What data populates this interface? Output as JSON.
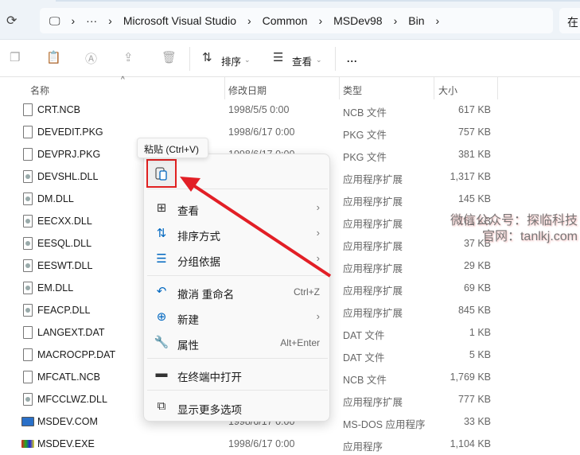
{
  "address": {
    "crumbs": [
      "Microsoft Visual Studio",
      "Common",
      "MSDev98",
      "Bin"
    ],
    "search_prefix": "在"
  },
  "toolbar": {
    "sort": "排序",
    "view": "查看",
    "more": "..."
  },
  "columns": {
    "name": "名称",
    "date": "修改日期",
    "type": "类型",
    "size": "大小"
  },
  "files": [
    {
      "name": "CRT.NCB",
      "date": "1998/5/5 0:00",
      "type": "NCB 文件",
      "size": "617 KB",
      "icon": "file"
    },
    {
      "name": "DEVEDIT.PKG",
      "date": "1998/6/17 0:00",
      "type": "PKG 文件",
      "size": "757 KB",
      "icon": "file"
    },
    {
      "name": "DEVPRJ.PKG",
      "date": "1998/6/17 0:00",
      "type": "PKG 文件",
      "size": "381 KB",
      "icon": "file"
    },
    {
      "name": "DEVSHL.DLL",
      "date": "",
      "type": "应用程序扩展",
      "size": "1,317 KB",
      "icon": "dll"
    },
    {
      "name": "DM.DLL",
      "date": "",
      "type": "应用程序扩展",
      "size": "145 KB",
      "icon": "dll"
    },
    {
      "name": "EECXX.DLL",
      "date": "",
      "type": "应用程序扩展",
      "size": "161 KB",
      "icon": "dll"
    },
    {
      "name": "EESQL.DLL",
      "date": "",
      "type": "应用程序扩展",
      "size": "37 KB",
      "icon": "dll"
    },
    {
      "name": "EESWT.DLL",
      "date": "",
      "type": "应用程序扩展",
      "size": "29 KB",
      "icon": "dll"
    },
    {
      "name": "EM.DLL",
      "date": "",
      "type": "应用程序扩展",
      "size": "69 KB",
      "icon": "dll"
    },
    {
      "name": "FEACP.DLL",
      "date": "",
      "type": "应用程序扩展",
      "size": "845 KB",
      "icon": "dll"
    },
    {
      "name": "LANGEXT.DAT",
      "date": "",
      "type": "DAT 文件",
      "size": "1 KB",
      "icon": "file"
    },
    {
      "name": "MACROCPP.DAT",
      "date": "",
      "type": "DAT 文件",
      "size": "5 KB",
      "icon": "file"
    },
    {
      "name": "MFCATL.NCB",
      "date": "",
      "type": "NCB 文件",
      "size": "1,769 KB",
      "icon": "file"
    },
    {
      "name": "MFCCLWZ.DLL",
      "date": "",
      "type": "应用程序扩展",
      "size": "777 KB",
      "icon": "dll"
    },
    {
      "name": "MSDEV.COM",
      "date": "1998/6/17 0:00",
      "type": "MS-DOS 应用程序",
      "size": "33 KB",
      "icon": "com"
    },
    {
      "name": "MSDEV.EXE",
      "date": "1998/6/17 0:00",
      "type": "应用程序",
      "size": "1,104 KB",
      "icon": "exe"
    }
  ],
  "context_menu": {
    "tooltip": "粘贴 (Ctrl+V)",
    "items": [
      {
        "label": "查看",
        "icon": "grid-icon",
        "glyph": "⊞",
        "submenu": true,
        "shortcut": ""
      },
      {
        "label": "排序方式",
        "icon": "sort-icon",
        "glyph": "⇅",
        "submenu": true,
        "shortcut": ""
      },
      {
        "label": "分组依据",
        "icon": "group-icon",
        "glyph": "☰",
        "submenu": true,
        "shortcut": ""
      },
      {
        "label": "撤消 重命名",
        "icon": "undo-icon",
        "glyph": "↶",
        "submenu": false,
        "shortcut": "Ctrl+Z"
      },
      {
        "label": "新建",
        "icon": "new-icon",
        "glyph": "⊕",
        "submenu": true,
        "shortcut": ""
      },
      {
        "label": "属性",
        "icon": "wrench-icon",
        "glyph": "🔧",
        "submenu": false,
        "shortcut": "Alt+Enter"
      },
      {
        "label": "在终端中打开",
        "icon": "terminal-icon",
        "glyph": "▬",
        "submenu": false,
        "shortcut": ""
      },
      {
        "label": "显示更多选项",
        "icon": "more-options-icon",
        "glyph": "⧉",
        "submenu": false,
        "shortcut": ""
      }
    ]
  },
  "watermark": {
    "line1": "微信公众号：探临科技",
    "line2": "官网：tanlkj.com"
  },
  "colors": {
    "accent": "#0067c0",
    "highlight": "#e02020"
  }
}
